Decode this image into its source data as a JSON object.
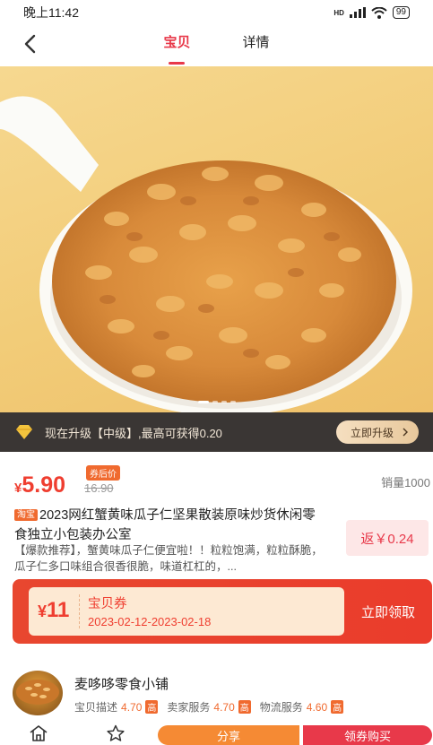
{
  "status_bar": {
    "time": "晚上11:42",
    "signal": "HD",
    "battery": "99"
  },
  "nav": {
    "tabs": [
      {
        "label": "宝贝",
        "active": true
      },
      {
        "label": "详情",
        "active": false
      }
    ]
  },
  "upgrade": {
    "text": "现在升级【中级】,最高可获得0.20",
    "button": "立即升级"
  },
  "product": {
    "currency": "¥",
    "price": "5.90",
    "coupon_tag": "券后价",
    "original_price": "16.90",
    "sales": "销量1000",
    "platform_badge": "淘宝",
    "title": "2023网红蟹黄味瓜子仁坚果散装原味炒货休闲零食独立小包装办公室",
    "rebate": "返￥0.24",
    "description": "【爆款推荐】，蟹黄味瓜子仁便宜啦！！粒粒饱满，粒粒酥脆，瓜子仁多口味组合很香很脆，味道杠杠的，..."
  },
  "coupon": {
    "currency": "¥",
    "amount": "11",
    "name": "宝贝券",
    "date_range": "2023-02-12-2023-02-18",
    "button": "立即领取"
  },
  "shop": {
    "name": "麦哆哆零食小铺",
    "scores": [
      {
        "label": "宝贝描述",
        "value": "4.70",
        "level": "高"
      },
      {
        "label": "卖家服务",
        "value": "4.70",
        "level": "高"
      },
      {
        "label": "物流服务",
        "value": "4.60",
        "level": "高"
      }
    ]
  },
  "bottom_bar": {
    "share": "分享",
    "buy": "领券购买"
  }
}
